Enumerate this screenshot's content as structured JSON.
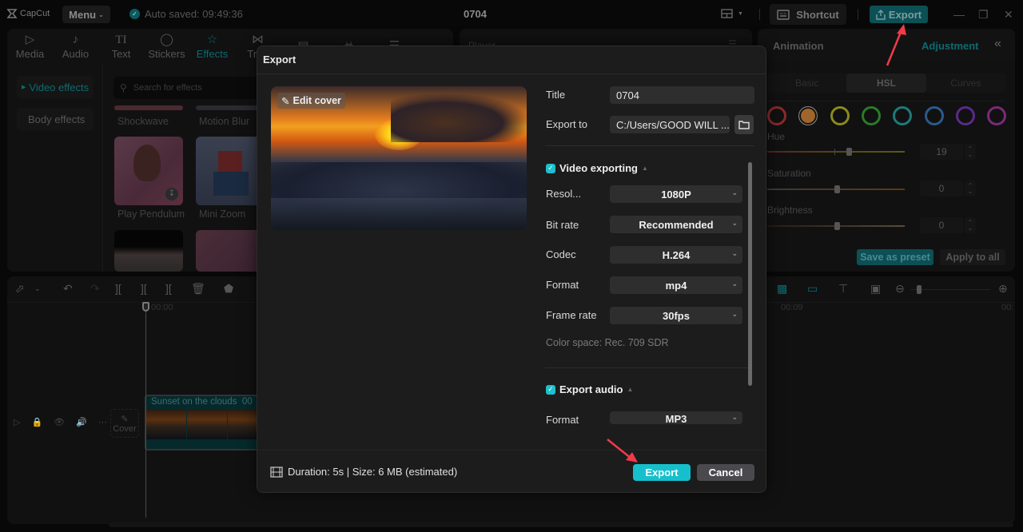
{
  "titlebar": {
    "brand": "CapCut",
    "menu_label": "Menu",
    "autosave_text": "Auto saved: 09:49:36",
    "project_title": "0704",
    "shortcut_label": "Shortcut",
    "export_label": "Export"
  },
  "tools": {
    "tabs": [
      {
        "label": "Media",
        "icon": "media-icon"
      },
      {
        "label": "Audio",
        "icon": "audio-icon"
      },
      {
        "label": "Text",
        "icon": "text-icon"
      },
      {
        "label": "Stickers",
        "icon": "stickers-icon"
      },
      {
        "label": "Effects",
        "icon": "effects-icon",
        "active": true
      },
      {
        "label": "Tran",
        "icon": "transitions-icon"
      }
    ],
    "side_nav": [
      {
        "label": "Video effects",
        "active": true
      },
      {
        "label": "Body effects"
      }
    ],
    "search_placeholder": "Search for effects",
    "effects": [
      "Shockwave",
      "Motion Blur",
      "Play Pendulum",
      "Mini Zoom"
    ]
  },
  "player": {
    "title": "Player"
  },
  "adjustment": {
    "tab_animation": "Animation",
    "tab_adjustment": "Adjustment",
    "segments": [
      "Basic",
      "HSL",
      "Curves"
    ],
    "active_segment": "HSL",
    "swatches": [
      {
        "name": "red",
        "color": "#8a2a2a"
      },
      {
        "name": "orange",
        "color": "#a0652a",
        "selected": true
      },
      {
        "name": "yellow",
        "color": "#8a8a1e"
      },
      {
        "name": "green",
        "color": "#2a7a2a"
      },
      {
        "name": "cyan",
        "color": "#1e7a7a"
      },
      {
        "name": "blue",
        "color": "#2a5a8a"
      },
      {
        "name": "purple",
        "color": "#5a2a8a"
      },
      {
        "name": "magenta",
        "color": "#7a2a7a"
      }
    ],
    "hue_label": "Hue",
    "hue_value": "19",
    "saturation_label": "Saturation",
    "saturation_value": "0",
    "brightness_label": "Brightness",
    "brightness_value": "0",
    "save_preset_label": "Save as preset",
    "apply_all_label": "Apply to all"
  },
  "timeline": {
    "ruler_start": "00:00",
    "ruler_mid": "00:09",
    "ruler_end": "00:",
    "cover_label": "Cover",
    "clip_name": "Sunset on the clouds",
    "clip_duration_prefix": "00"
  },
  "dialog": {
    "title": "Export",
    "edit_cover_label": "Edit cover",
    "title_label": "Title",
    "title_value": "0704",
    "export_to_label": "Export to",
    "export_to_value": "C:/Users/GOOD WILL ...",
    "video_section": "Video exporting",
    "video_checked": true,
    "resolution_label": "Resol...",
    "resolution_value": "1080P",
    "bitrate_label": "Bit rate",
    "bitrate_value": "Recommended",
    "codec_label": "Codec",
    "codec_value": "H.264",
    "format_label": "Format",
    "format_value": "mp4",
    "framerate_label": "Frame rate",
    "framerate_value": "30fps",
    "color_space": "Color space: Rec. 709 SDR",
    "audio_section": "Export audio",
    "audio_checked": true,
    "audio_format_label": "Format",
    "audio_format_value": "MP3",
    "footer_info": "Duration: 5s | Size: 6 MB (estimated)",
    "export_button": "Export",
    "cancel_button": "Cancel"
  }
}
